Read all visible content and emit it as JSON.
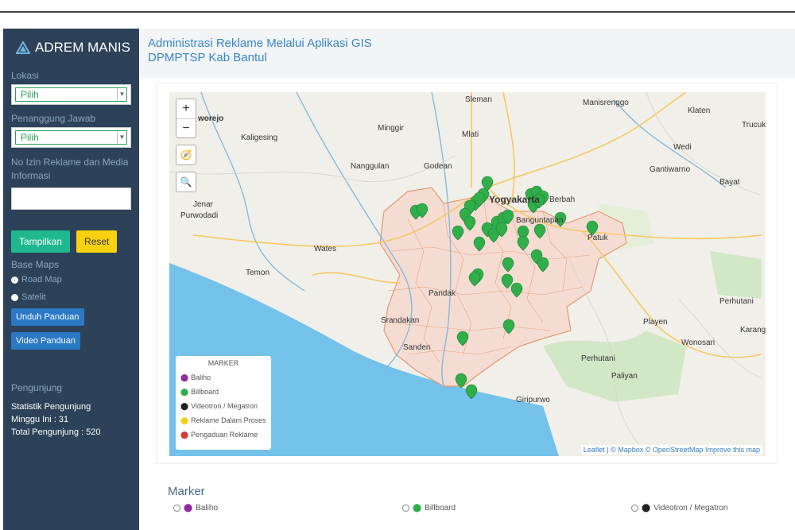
{
  "app": {
    "brand": "ADREM MANIS",
    "header_line1": "Administrasi Reklame Melalui Aplikasi GIS",
    "header_line2": "DPMPTSP Kab Bantul"
  },
  "sidebar": {
    "lokasi_label": "Lokasi",
    "lokasi_value": "Pilih",
    "penanggung_label": "Penanggung Jawab",
    "penanggung_value": "Pilih",
    "izin_label": "No Izin Reklame dan Media Informasi",
    "izin_value": "",
    "tampilkan_label": "Tampilkan",
    "reset_label": "Reset",
    "basemaps_label": "Base Maps",
    "road_map_label": "Road Map",
    "satelit_label": "Satelit",
    "unduh_label": "Unduh Panduan",
    "video_label": "Video Panduan",
    "pengunjung_label": "Pengunjung",
    "statistik_label": "Statistik Pengunjung",
    "minggu_ini": "Minggu Ini : 31",
    "total_pengunjung": "Total Pengunjung : 520"
  },
  "map": {
    "zoom_in": "+",
    "zoom_out": "−",
    "legend_title": "MARKER",
    "legend": [
      {
        "label": "Baliho",
        "color": "#8e2d9e"
      },
      {
        "label": "Billboard",
        "color": "#2fae4a"
      },
      {
        "label": "Videotron / Megatron",
        "color": "#222222"
      },
      {
        "label": "Reklame Dalam Proses",
        "color": "#f4d01a"
      },
      {
        "label": "Pengaduan Reklame",
        "color": "#d43a3a"
      }
    ],
    "attribution": "Leaflet | © Mapbox © OpenStreetMap Improve this map",
    "places": {
      "sleman": "Sleman",
      "manisrenggo": "Manisrenggo",
      "klaten": "Klaten",
      "kulonprogo": "worejo",
      "kaligesing": "Kaligesing",
      "minggir": "Minggir",
      "mlati": "Mlati",
      "trucuk": "Trucuk",
      "wedi": "Wedi",
      "nanggulan": "Nanggulan",
      "godean": "Godean",
      "gantiwarno": "Gantiwarno",
      "yogyakarta": "Yogyakarta",
      "berbah": "Berbah",
      "bayat": "Bayat",
      "jenar": "Jenar",
      "purwodadi": "Purwodadi",
      "banguntapan": "Banguntapan",
      "patuk": "Patuk",
      "wates": "Wates",
      "temon": "Temon",
      "pandak": "Pandak",
      "srandakan": "Srandakan",
      "sanden": "Sanden",
      "perhutani1": "Perhutani",
      "perhutani2": "Perhutani",
      "playen": "Playen",
      "karang": "Karang",
      "wonosari": "Wonosari",
      "paliyan": "Paliyan",
      "giripurwo": "Giripurwo"
    }
  },
  "marker_panel": {
    "title": "Marker",
    "options": [
      {
        "label": "Baliho",
        "color": "#8e2d9e"
      },
      {
        "label": "Billboard",
        "color": "#2fae4a"
      },
      {
        "label": "Videotron / Megatron",
        "color": "#222222"
      }
    ]
  }
}
